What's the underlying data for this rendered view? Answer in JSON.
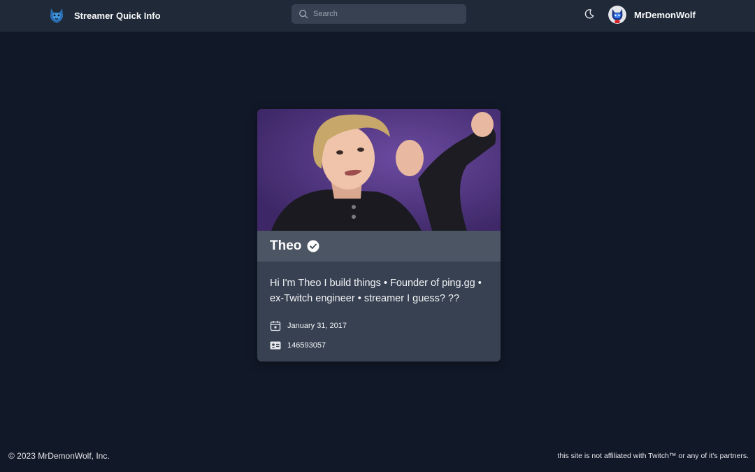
{
  "navbar": {
    "brand_title": "Streamer Quick Info",
    "brand_icon": "wolf-logo-icon",
    "search": {
      "placeholder": "Search",
      "value": ""
    },
    "theme_toggle_icon": "moon-icon",
    "user": {
      "name": "MrDemonWolf",
      "avatar_icon": "wolf-avatar-icon"
    }
  },
  "card": {
    "name": "Theo",
    "verified_icon": "verified-check-icon",
    "bio": "Hi I'm Theo I build things • Founder of ping.gg • ex-Twitch engineer • streamer I guess? ??",
    "created_date": "January 31, 2017",
    "created_icon": "calendar-icon",
    "user_id": "146593057",
    "id_icon": "id-card-icon"
  },
  "footer": {
    "copyright": "© 2023 MrDemonWolf, Inc.",
    "disclaimer": "this site is not affiliated with Twitch™ or any of it's partners."
  },
  "colors": {
    "background": "#111827",
    "navbar": "#1f2937",
    "card": "#374151",
    "card_header": "#4b5563",
    "photo_bg": "#5b3b86"
  }
}
